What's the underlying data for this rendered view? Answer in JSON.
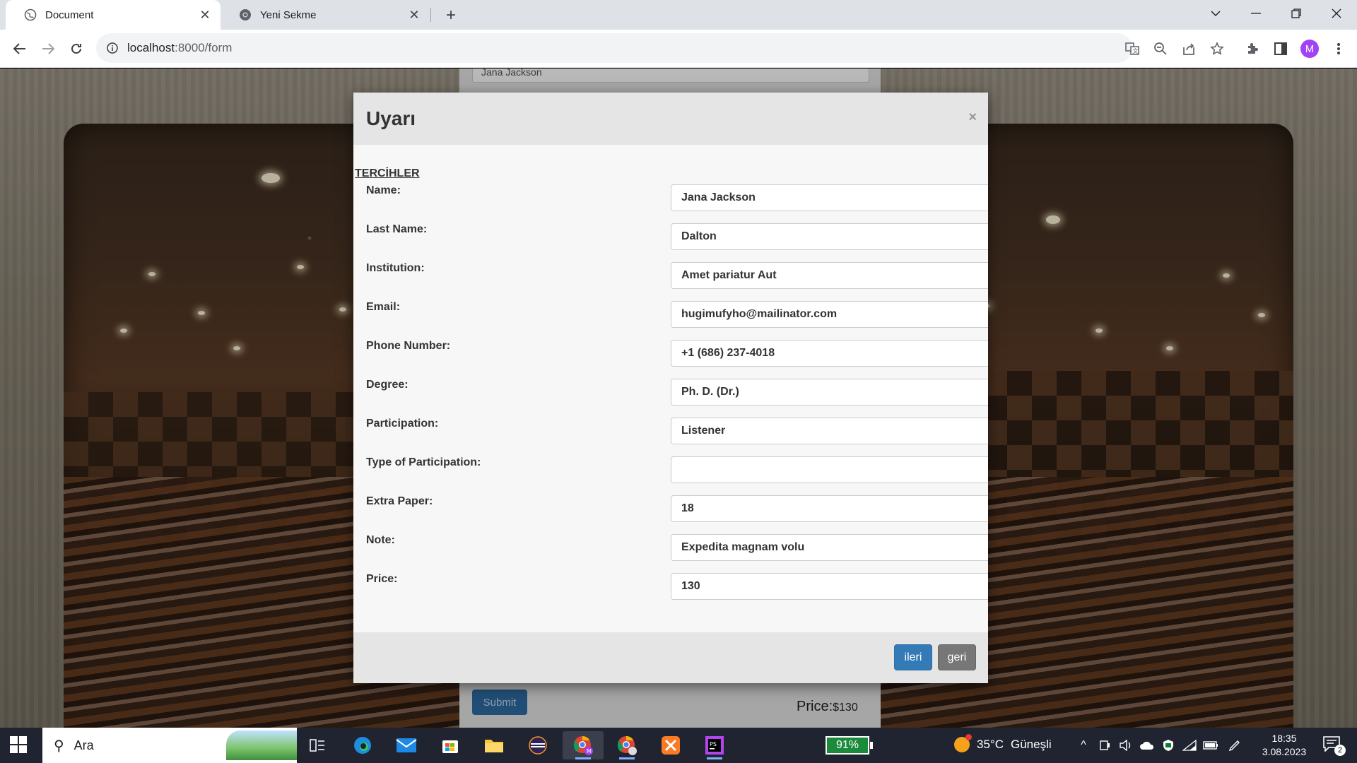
{
  "browser": {
    "tabs": [
      {
        "title": "Document",
        "active": true
      },
      {
        "title": "Yeni Sekme",
        "active": false
      }
    ],
    "url_host": "localhost",
    "url_path": ":8000/form",
    "profile_initial": "M"
  },
  "background_page": {
    "name_value": "Jana Jackson",
    "submit_label": "Submit",
    "price_label": "Price:",
    "price_value": "$130"
  },
  "modal": {
    "title": "Uyarı",
    "close_glyph": "×",
    "section_title": "TERCİHLER",
    "fields": [
      {
        "label": "Name:",
        "value": "Jana Jackson"
      },
      {
        "label": "Last Name:",
        "value": "Dalton"
      },
      {
        "label": "Institution:",
        "value": "Amet pariatur Aut"
      },
      {
        "label": "Email:",
        "value": "hugimufyho@mailinator.com"
      },
      {
        "label": "Phone Number:",
        "value": "+1 (686) 237-4018"
      },
      {
        "label": "Degree:",
        "value": "Ph. D. (Dr.)"
      },
      {
        "label": "Participation:",
        "value": "Listener"
      },
      {
        "label": "Type of Participation:",
        "value": ""
      },
      {
        "label": "Extra Paper:",
        "value": "18"
      },
      {
        "label": "Note:",
        "value": "Expedita magnam volu"
      },
      {
        "label": "Price:",
        "value": "130"
      }
    ],
    "next_label": "ileri",
    "back_label": "geri"
  },
  "taskbar": {
    "search_placeholder": "Ara",
    "battery": "91%",
    "weather_temp": "35°C",
    "weather_desc": "Güneşli",
    "time": "18:35",
    "date": "3.08.2023",
    "notification_count": "2"
  },
  "colors": {
    "primary_button": "#337ab7",
    "secondary_button": "#777777",
    "modal_header": "#e5e5e5",
    "taskbar": "#1f2430"
  }
}
